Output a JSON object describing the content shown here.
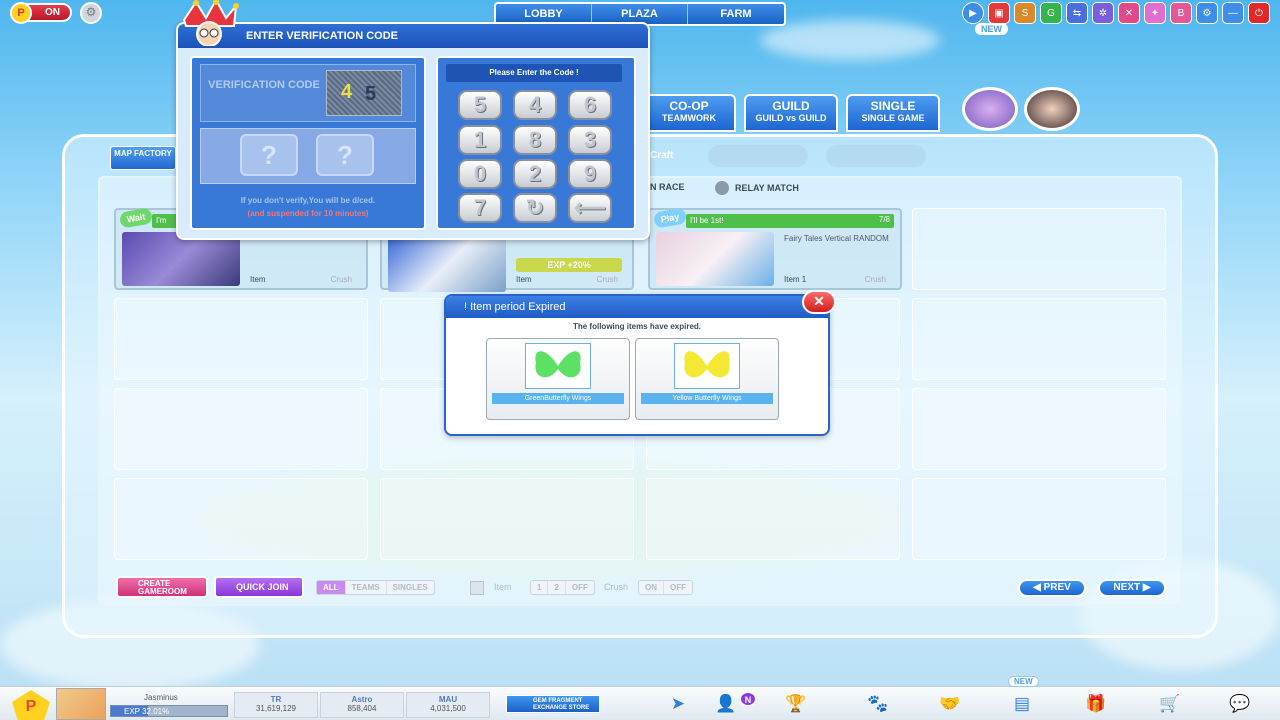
{
  "topbar": {
    "on_label": "ON",
    "nav_tabs": [
      "LOBBY",
      "PLAZA",
      "FARM"
    ],
    "new_badge": "NEW"
  },
  "mode_tabs": [
    {
      "title": "CO-OP",
      "sub": "TEAMWORK"
    },
    {
      "title": "GUILD",
      "sub": "GUILD vs GUILD"
    },
    {
      "title": "SINGLE",
      "sub": "SINGLE GAME"
    }
  ],
  "lobby": {
    "map_factory": "MAP FACTORY",
    "craft": "Craft",
    "race_label": "N RACE",
    "relay_match": "RELAY MATCH",
    "rooms": [
      {
        "status": "Wait",
        "bar": "I'm",
        "item": "Item",
        "crush": "Crush"
      },
      {
        "exp_boost": "EXP +20%",
        "item": "Item",
        "crush": "Crush"
      },
      {
        "status": "Play",
        "bar": "I'll be 1st!",
        "count": "7/8",
        "map": "Fairy Tales Vertical RANDOM",
        "item": "Item 1",
        "crush": "Crush"
      }
    ]
  },
  "bottom_controls": {
    "create_room": "CREATE GAMEROOM",
    "quick_join": "QUICK JOIN",
    "mode_filters": [
      "ALL",
      "TEAMS",
      "SINGLES"
    ],
    "item_label": "Item",
    "item_filters": [
      "1",
      "2",
      "OFF"
    ],
    "crush_label": "Crush",
    "crush_filters": [
      "ON",
      "OFF"
    ],
    "prev": "PREV",
    "next": "NEXT"
  },
  "verification": {
    "title": "ENTER VERIFICATION CODE",
    "label": "VERIFICATION CODE",
    "captcha": [
      "4",
      "5"
    ],
    "slots": [
      "?",
      "?"
    ],
    "warning": "If you don't verify,You will be d/ced.",
    "warning_2": "(and suspended for 10 minutes)",
    "prompt": "Please Enter the Code !",
    "keys": [
      "5",
      "4",
      "6",
      "1",
      "8",
      "3",
      "0",
      "2",
      "9",
      "7"
    ]
  },
  "expired_dialog": {
    "title": "! Item period Expired",
    "message": "The following items have expired.",
    "items": [
      {
        "name": "GreenButterfly Wings",
        "color": "#3fdc4a"
      },
      {
        "name": "Yellow Butterfly Wings",
        "color": "#f3e51c"
      }
    ]
  },
  "hud": {
    "nickname": "Jasminus",
    "exp_label": "EXP 32.01%",
    "exp_percent": 32.01,
    "stats": [
      {
        "label": "TR",
        "value": "31,619,129"
      },
      {
        "label": "Astro",
        "value": "858,404"
      },
      {
        "label": "MAU",
        "value": "4,031,500"
      }
    ],
    "gem_store": "GEM FRAGMENT EXCHANGE STORE",
    "new_badge": "NEW"
  }
}
